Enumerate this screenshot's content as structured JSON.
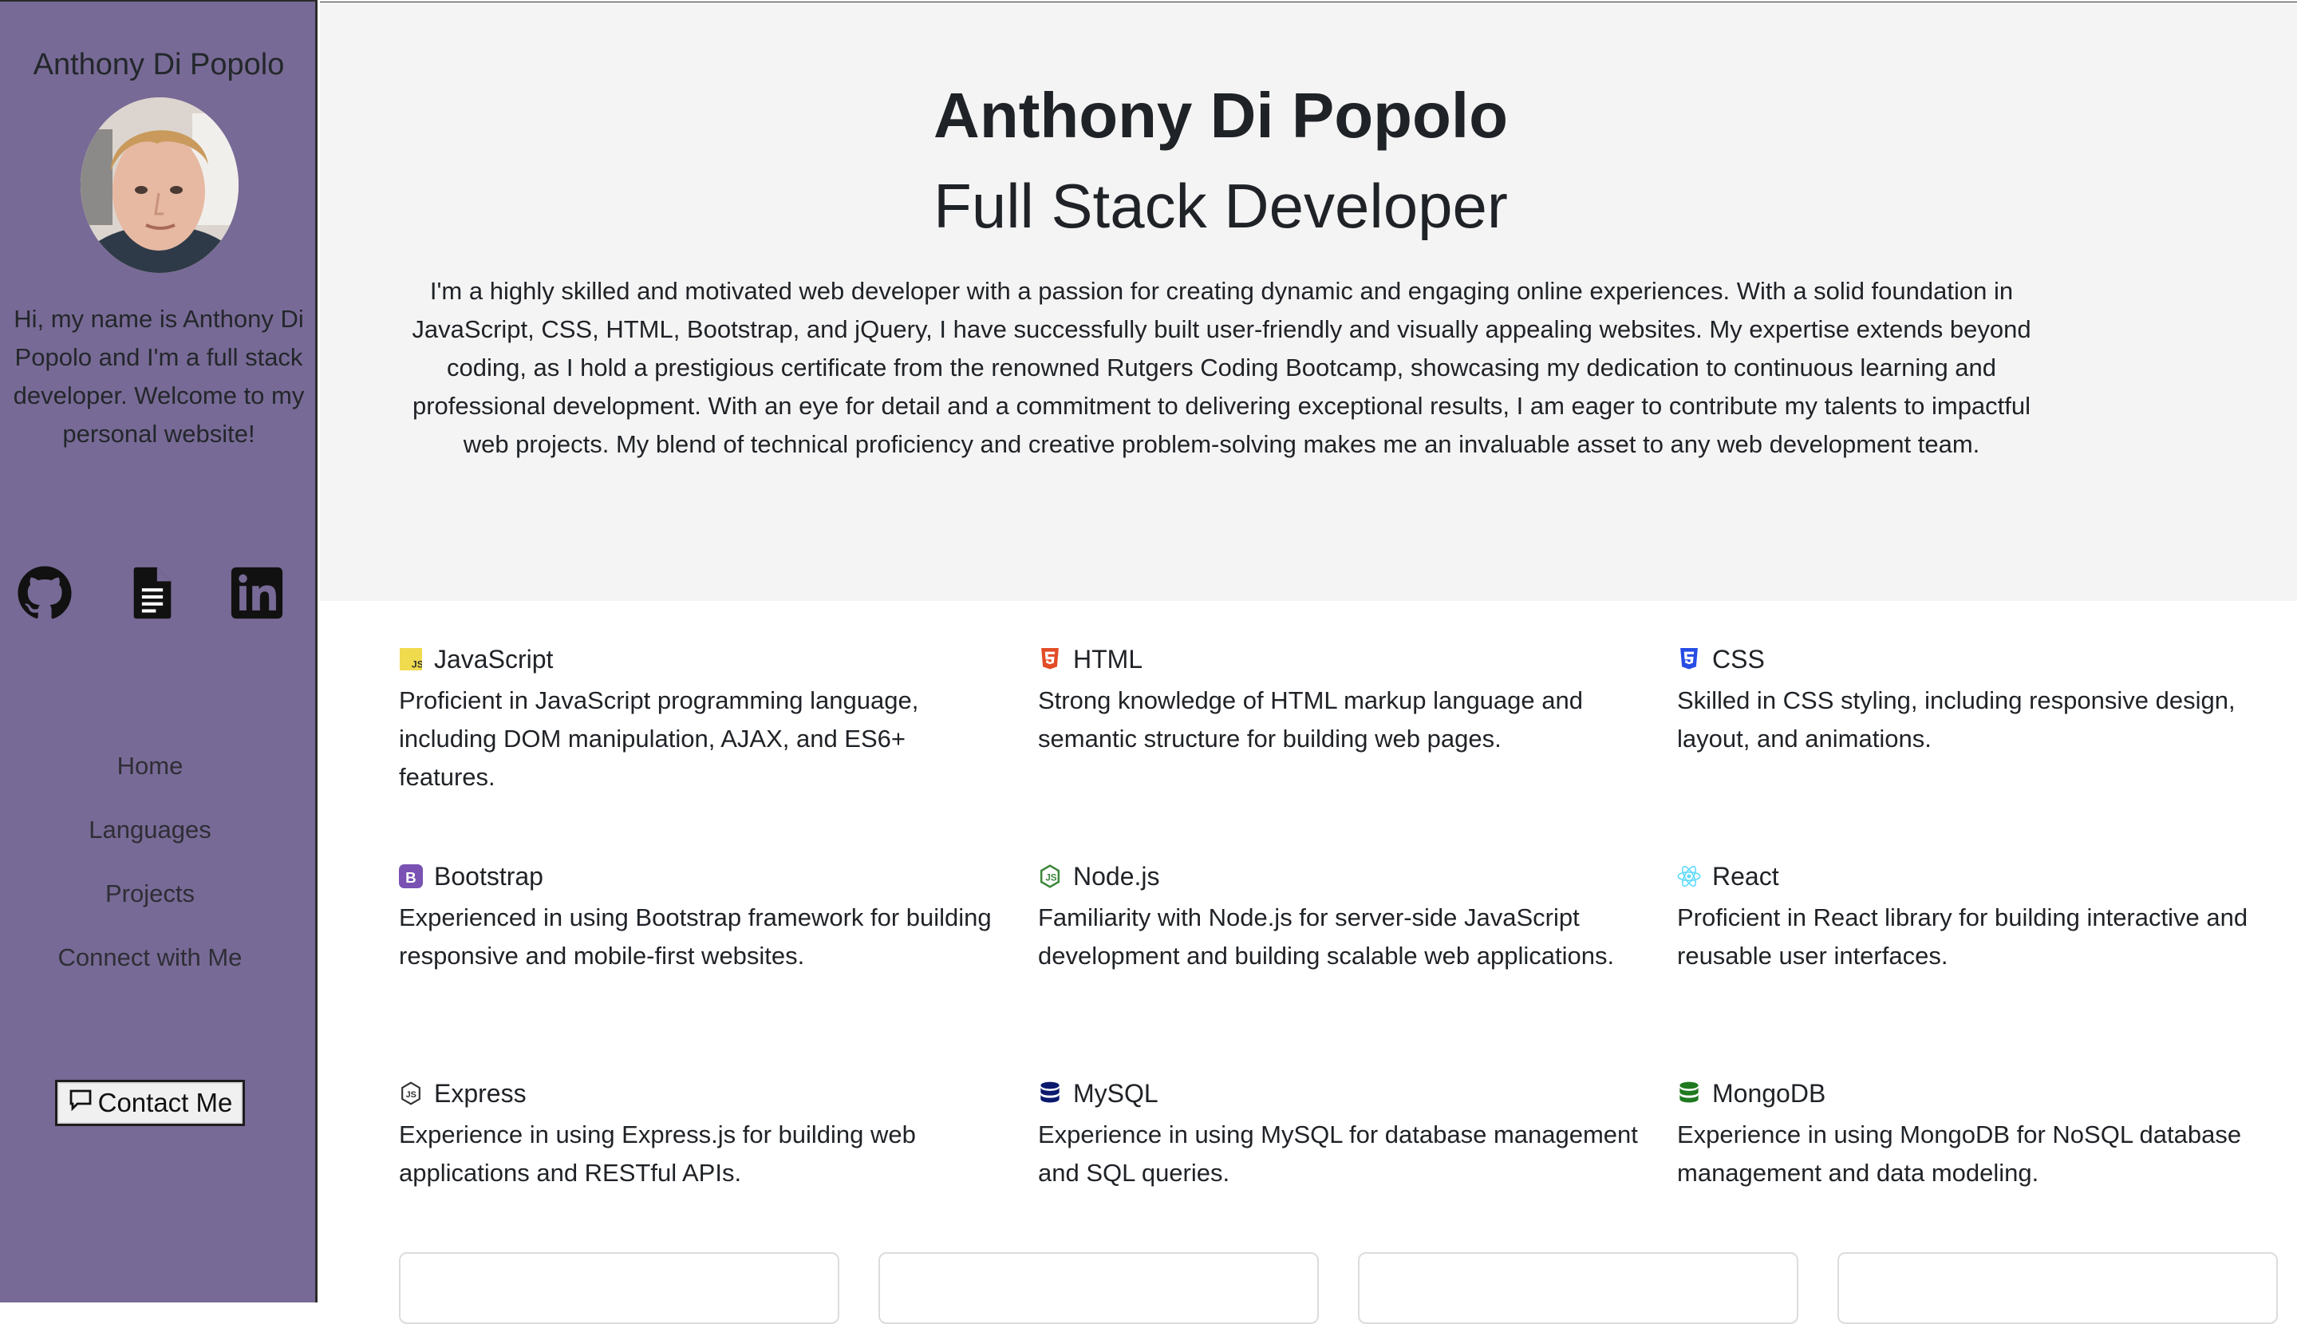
{
  "sidebar": {
    "name": "Anthony Di Popolo",
    "bio": "Hi, my name is Anthony Di Popolo and I'm a full stack developer. Welcome to my personal website!",
    "social": [
      "github-icon",
      "resume-file-icon",
      "linkedin-icon"
    ],
    "nav": [
      {
        "label": "Home"
      },
      {
        "label": "Languages"
      },
      {
        "label": "Projects"
      },
      {
        "label": "Connect with Me"
      }
    ],
    "contact_label": "Contact Me"
  },
  "hero": {
    "title": "Anthony Di Popolo",
    "subtitle": "Full Stack Developer",
    "bio": "I'm a highly skilled and motivated web developer with a passion for creating dynamic and engaging online experiences. With a solid foundation in JavaScript, CSS, HTML, Bootstrap, and jQuery, I have successfully built user-friendly and visually appealing websites. My expertise extends beyond coding, as I hold a prestigious certificate from the renowned Rutgers Coding Bootcamp, showcasing my dedication to continuous learning and professional development. With an eye for detail and a commitment to delivering exceptional results, I am eager to contribute my talents to impactful web projects. My blend of technical proficiency and creative problem-solving makes me an invaluable asset to any web development team."
  },
  "skills": [
    {
      "name": "JavaScript",
      "icon": "javascript-icon",
      "desc": "Proficient in JavaScript programming language, including DOM manipulation, AJAX, and ES6+ features."
    },
    {
      "name": "HTML",
      "icon": "html5-icon",
      "desc": "Strong knowledge of HTML markup language and semantic structure for building web pages."
    },
    {
      "name": "CSS",
      "icon": "css3-icon",
      "desc": "Skilled in CSS styling, including responsive design, layout, and animations."
    },
    {
      "name": "Bootstrap",
      "icon": "bootstrap-icon",
      "desc": "Experienced in using Bootstrap framework for building responsive and mobile-first websites."
    },
    {
      "name": "Node.js",
      "icon": "nodejs-icon",
      "desc": "Familiarity with Node.js for server-side JavaScript development and building scalable web applications."
    },
    {
      "name": "React",
      "icon": "react-icon",
      "desc": "Proficient in React library for building interactive and reusable user interfaces."
    },
    {
      "name": "Express",
      "icon": "express-icon",
      "desc": "Experience in using Express.js for building web applications and RESTful APIs."
    },
    {
      "name": "MySQL",
      "icon": "mysql-database-icon",
      "desc": "Experience in using MySQL for database management and SQL queries."
    },
    {
      "name": "MongoDB",
      "icon": "mongodb-database-icon",
      "desc": "Experience in using MongoDB for NoSQL database management and data modeling."
    }
  ],
  "colors": {
    "sidebar_bg": "#786a96",
    "hero_bg": "#f4f4f4",
    "javascript": "#f0db4f",
    "html": "#e34c26",
    "css": "#264de4",
    "bootstrap": "#7952b3",
    "node": "#3c873a",
    "react": "#61dafb",
    "mysql": "#0b1a6e",
    "mongodb": "#1f7a1f"
  }
}
